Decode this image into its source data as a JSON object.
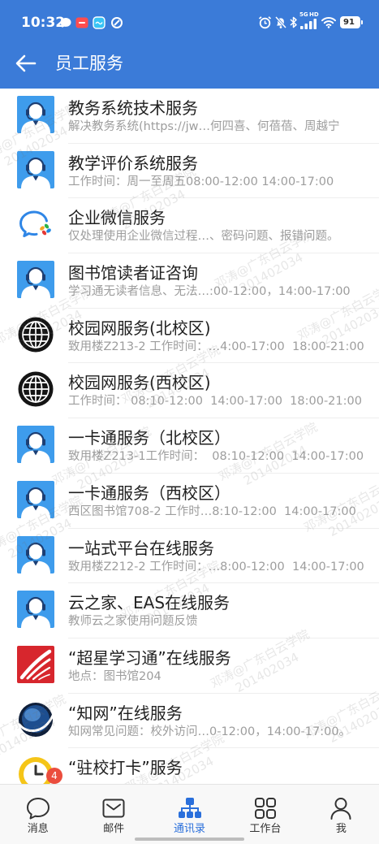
{
  "status_bar": {
    "time": "10:32",
    "network_gen": "5G",
    "network_hd": "HD",
    "battery_level": "91",
    "left_icons": [
      "chat-bubble-icon",
      "red-app-icon",
      "blue-app-icon",
      "ring-app-icon"
    ],
    "right_icons": [
      "alarm-icon",
      "mute-bell-icon",
      "bluetooth-icon",
      "signal-icon",
      "wifi-icon",
      "battery-icon"
    ]
  },
  "header": {
    "back_icon": "arrow-left-icon",
    "title": "员工服务"
  },
  "services": [
    {
      "icon": "agent-avatar-icon",
      "title": "教务系统技术服务",
      "subtitle": "解决教务系统(https://jw…何四喜、何蓓蓓、周越宁"
    },
    {
      "icon": "agent-avatar-icon",
      "title": "教学评价系统服务",
      "subtitle": "工作时间：周一至周五08:00-12:00 14:00-17:00"
    },
    {
      "icon": "wecom-logo-icon",
      "title": "企业微信服务",
      "subtitle": "仅处理使用企业微信过程…、密码问题、报错问题。"
    },
    {
      "icon": "agent-avatar-icon",
      "title": "图书馆读者证咨询",
      "subtitle": "学习通无读者信息、无法…:00-12:00，14:00-17:00"
    },
    {
      "icon": "globe-icon",
      "title": "校园网服务(北校区)",
      "subtitle": "致用楼Z213-2 工作时间：…4:00-17:00  18:00-21:00"
    },
    {
      "icon": "globe-icon",
      "title": "校园网服务(西校区)",
      "subtitle": "工作时间： 08:10-12:00  14:00-17:00  18:00-21:00"
    },
    {
      "icon": "agent-avatar-icon",
      "title": "一卡通服务（北校区）",
      "subtitle": "致用楼Z213-1工作时间：  08:10-12:00  14:00-17:00"
    },
    {
      "icon": "agent-avatar-icon",
      "title": "一卡通服务（西校区）",
      "subtitle": "西区图书馆708-2 工作时…8:10-12:00  14:00-17:00"
    },
    {
      "icon": "agent-avatar-icon",
      "title": "一站式平台在线服务",
      "subtitle": "致用楼Z212-2 工作时间：…8:00-12:00  14:00-17:00"
    },
    {
      "icon": "agent-avatar-icon",
      "title": "云之家、EAS在线服务",
      "subtitle": "教师云之家使用问题反馈"
    },
    {
      "icon": "chaoxing-logo-icon",
      "title": "“超星学习通”在线服务",
      "subtitle": "地点：图书馆204"
    },
    {
      "icon": "cnki-globe-icon",
      "title": "“知网”在线服务",
      "subtitle": "知网常见问题：校外访问…0-12:00，14:00-17:00。"
    },
    {
      "icon": "clock-icon",
      "title": "“驻校打卡”服务"
    }
  ],
  "tab_bar": {
    "items": [
      {
        "label": "消息",
        "icon": "chat-bubble-icon",
        "badge": "4",
        "active": false
      },
      {
        "label": "邮件",
        "icon": "mail-icon",
        "active": false
      },
      {
        "label": "通讯录",
        "icon": "org-chart-icon",
        "active": true
      },
      {
        "label": "工作台",
        "icon": "grid-icon",
        "active": false
      },
      {
        "label": "我",
        "icon": "person-icon",
        "active": false
      }
    ]
  },
  "watermark": {
    "line1": "邓涛@广东白云学院",
    "line2": "201402034"
  },
  "colors": {
    "header_bg": "#3b7bd8",
    "accent": "#2a6fdb",
    "badge": "#eb4d3d",
    "title_text": "#1f1f1f",
    "subtitle_text": "#9d9d9d"
  }
}
